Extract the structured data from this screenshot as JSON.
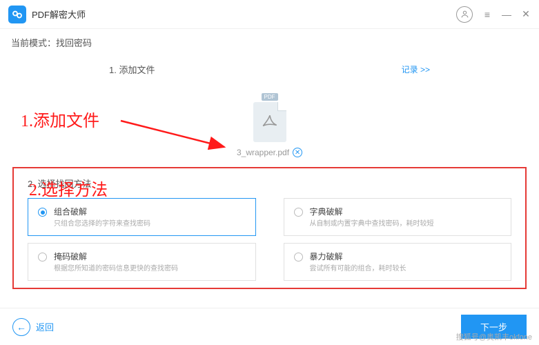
{
  "app": {
    "title": "PDF解密大师"
  },
  "modeBar": {
    "label": "当前模式：",
    "value": "找回密码"
  },
  "step1": {
    "label": "1. 添加文件",
    "historyLink": "记录 >>"
  },
  "file": {
    "badge": "PDF",
    "name": "3_wrapper.pdf"
  },
  "step2": {
    "title": "2. 选择找回方法",
    "methods": [
      {
        "name": "组合破解",
        "desc": "只组合您选择的字符来查找密码"
      },
      {
        "name": "字典破解",
        "desc": "从自制或内置字典中查找密码，耗时较短"
      },
      {
        "name": "掩码破解",
        "desc": "根据您所知道的密码信息更快的查找密码"
      },
      {
        "name": "暴力破解",
        "desc": "尝试所有可能的组合，耗时较长"
      }
    ]
  },
  "footer": {
    "back": "返回",
    "next": "下一步"
  },
  "annotations": {
    "a1": "1.添加文件",
    "a2": "2.选择方法"
  },
  "watermark": "搜狐号@奥凯丰okfone"
}
